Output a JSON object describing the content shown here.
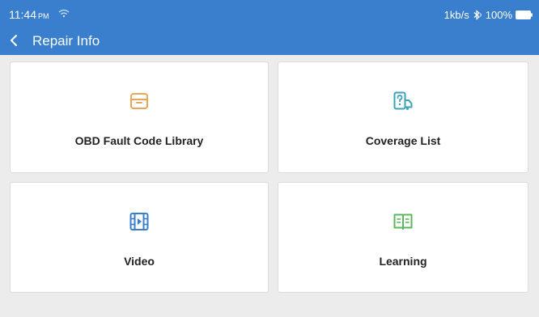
{
  "status_bar": {
    "time": "11:44",
    "ampm": "PM",
    "network_speed": "1kb/s",
    "battery": "100%"
  },
  "header": {
    "title": "Repair Info"
  },
  "cards": [
    {
      "label": "OBD Fault Code Library",
      "icon": "archive-box-icon",
      "color": "#e9a65a"
    },
    {
      "label": "Coverage List",
      "icon": "question-vehicle-icon",
      "color": "#3aa3b8"
    },
    {
      "label": "Video",
      "icon": "film-play-icon",
      "color": "#3a7fce"
    },
    {
      "label": "Learning",
      "icon": "open-book-icon",
      "color": "#5cb85c"
    }
  ],
  "colors": {
    "header": "#3a7fce",
    "background": "#ececec"
  }
}
